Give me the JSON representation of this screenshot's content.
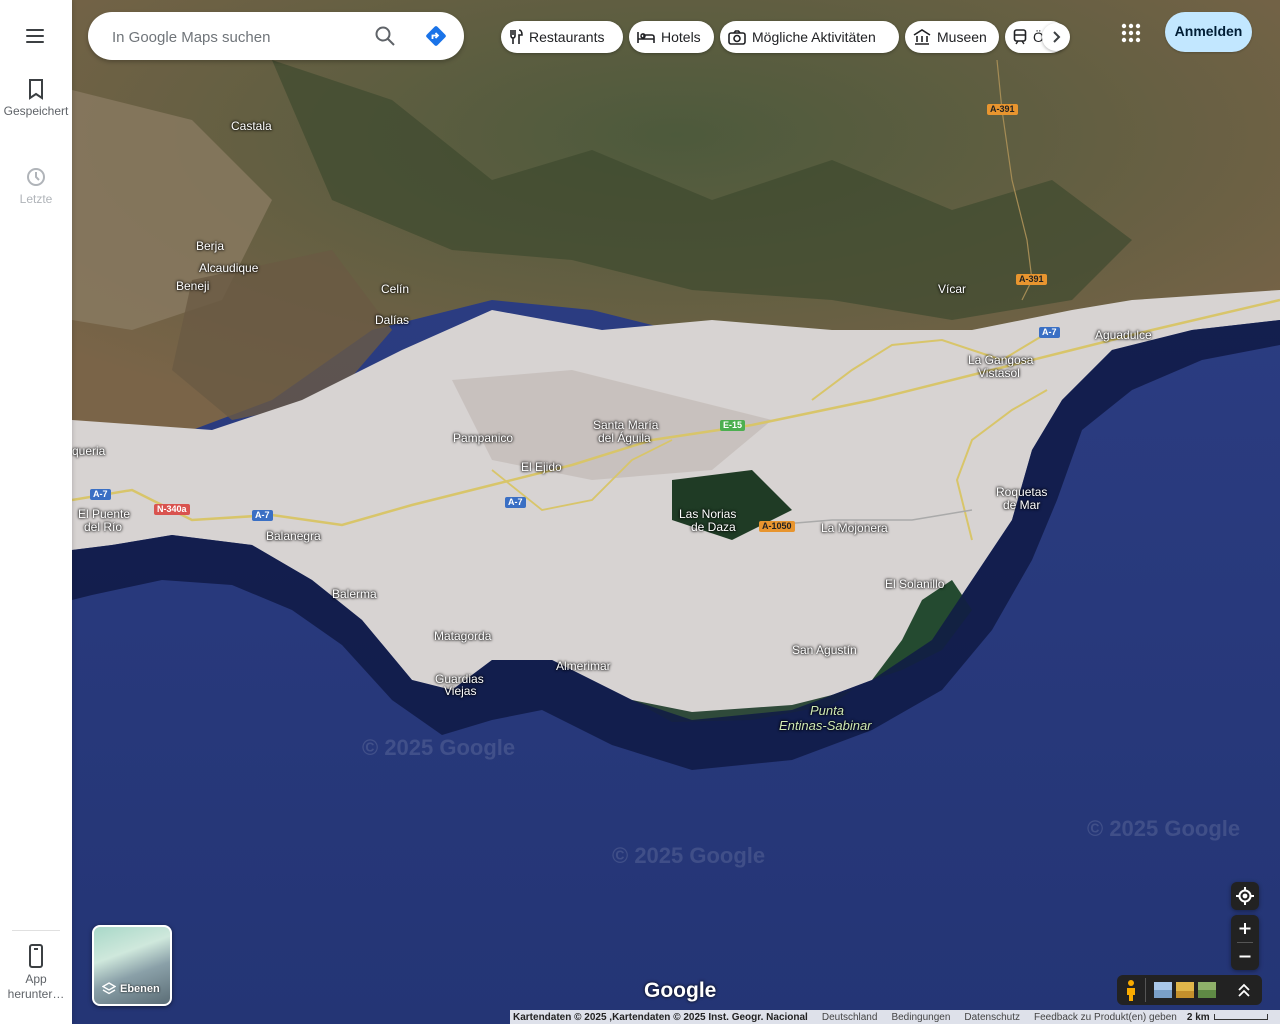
{
  "sidebar": {
    "items": [
      {
        "label": "Gespeichert",
        "icon": "bookmark-icon"
      },
      {
        "label": "Letzte",
        "icon": "history-icon"
      }
    ],
    "app_label": "App herunter…"
  },
  "search": {
    "placeholder": "In Google Maps suchen"
  },
  "chips": [
    {
      "label": "Restaurants",
      "icon": "restaurant-icon"
    },
    {
      "label": "Hotels",
      "icon": "hotel-icon"
    },
    {
      "label": "Mögliche Aktivitäten",
      "icon": "camera-icon"
    },
    {
      "label": "Museen",
      "icon": "museum-icon"
    },
    {
      "label": "Ö",
      "icon": "transit-icon"
    }
  ],
  "signin_label": "Anmelden",
  "layers_label": "Ebenen",
  "google_label": "Google",
  "places": {
    "castala": "Castala",
    "berja": "Berja",
    "alcaudique": "Alcaudique",
    "beneji": "Beneji",
    "celin": "Celín",
    "dalias": "Dalías",
    "vicar": "Vícar",
    "aguadulce": "Aguadulce",
    "la_gangosa": "La Gangosa",
    "vistasol": "Vistasol",
    "santa_maria": "Santa María",
    "del_aguila": "del Águila",
    "pampanico": "Pampanico",
    "el_ejido": "El Ejido",
    "queria": "queria",
    "el_puente": "El Puente",
    "del_rio": "del Río",
    "balanegra": "Balanegra",
    "las_norias": "Las Norias",
    "de_daza": "de Daza",
    "la_mojonera": "La Mojonera",
    "roquetas": "Roquetas",
    "de_mar": "de Mar",
    "el_solanillo": "El Solanillo",
    "balerma": "Balerma",
    "matagorda": "Matagorda",
    "almerimar": "Almerimar",
    "guardias": "Guardias",
    "viejas": "Viejas",
    "san_agustin": "San Agustín",
    "punta": "Punta",
    "entinas": "Entinas-Sabinar"
  },
  "roads": {
    "a391_top": "A-391",
    "a391_mid": "A-391",
    "a7_right": "A-7",
    "e15": "E-15",
    "a7_left": "A-7",
    "n340a": "N-340a",
    "a7_balanegra": "A-7",
    "a7_center": "A-7",
    "a1050": "A-1050"
  },
  "watermark": "© 2025 Google",
  "footer": {
    "attribution": "Kartendaten © 2025 ,Kartendaten © 2025 Inst. Geogr. Nacional",
    "country": "Deutschland",
    "terms": "Bedingungen",
    "privacy": "Datenschutz",
    "feedback": "Feedback zu Produkt(en) geben",
    "scale": "2 km"
  }
}
